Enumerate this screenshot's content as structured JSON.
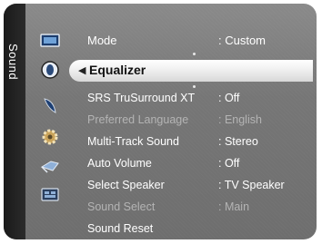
{
  "menu": {
    "category": "Sound",
    "mode": {
      "label": "Mode",
      "value": ": Custom"
    },
    "selected": {
      "label": "Equalizer"
    },
    "items": [
      {
        "label": "SRS TruSurround XT",
        "value": ": Off",
        "enabled": true
      },
      {
        "label": "Preferred Language",
        "value": ": English",
        "enabled": false
      },
      {
        "label": "Multi-Track Sound",
        "value": ": Stereo",
        "enabled": true
      },
      {
        "label": "Auto Volume",
        "value": ": Off",
        "enabled": true
      },
      {
        "label": "Select Speaker",
        "value": ": TV Speaker",
        "enabled": true
      },
      {
        "label": "Sound Select",
        "value": ": Main",
        "enabled": false
      },
      {
        "label": "Sound Reset",
        "value": "",
        "enabled": true
      }
    ]
  },
  "icons": [
    "picture-icon",
    "sound-icon",
    "channel-icon",
    "setup-icon",
    "input-icon",
    "application-icon"
  ]
}
